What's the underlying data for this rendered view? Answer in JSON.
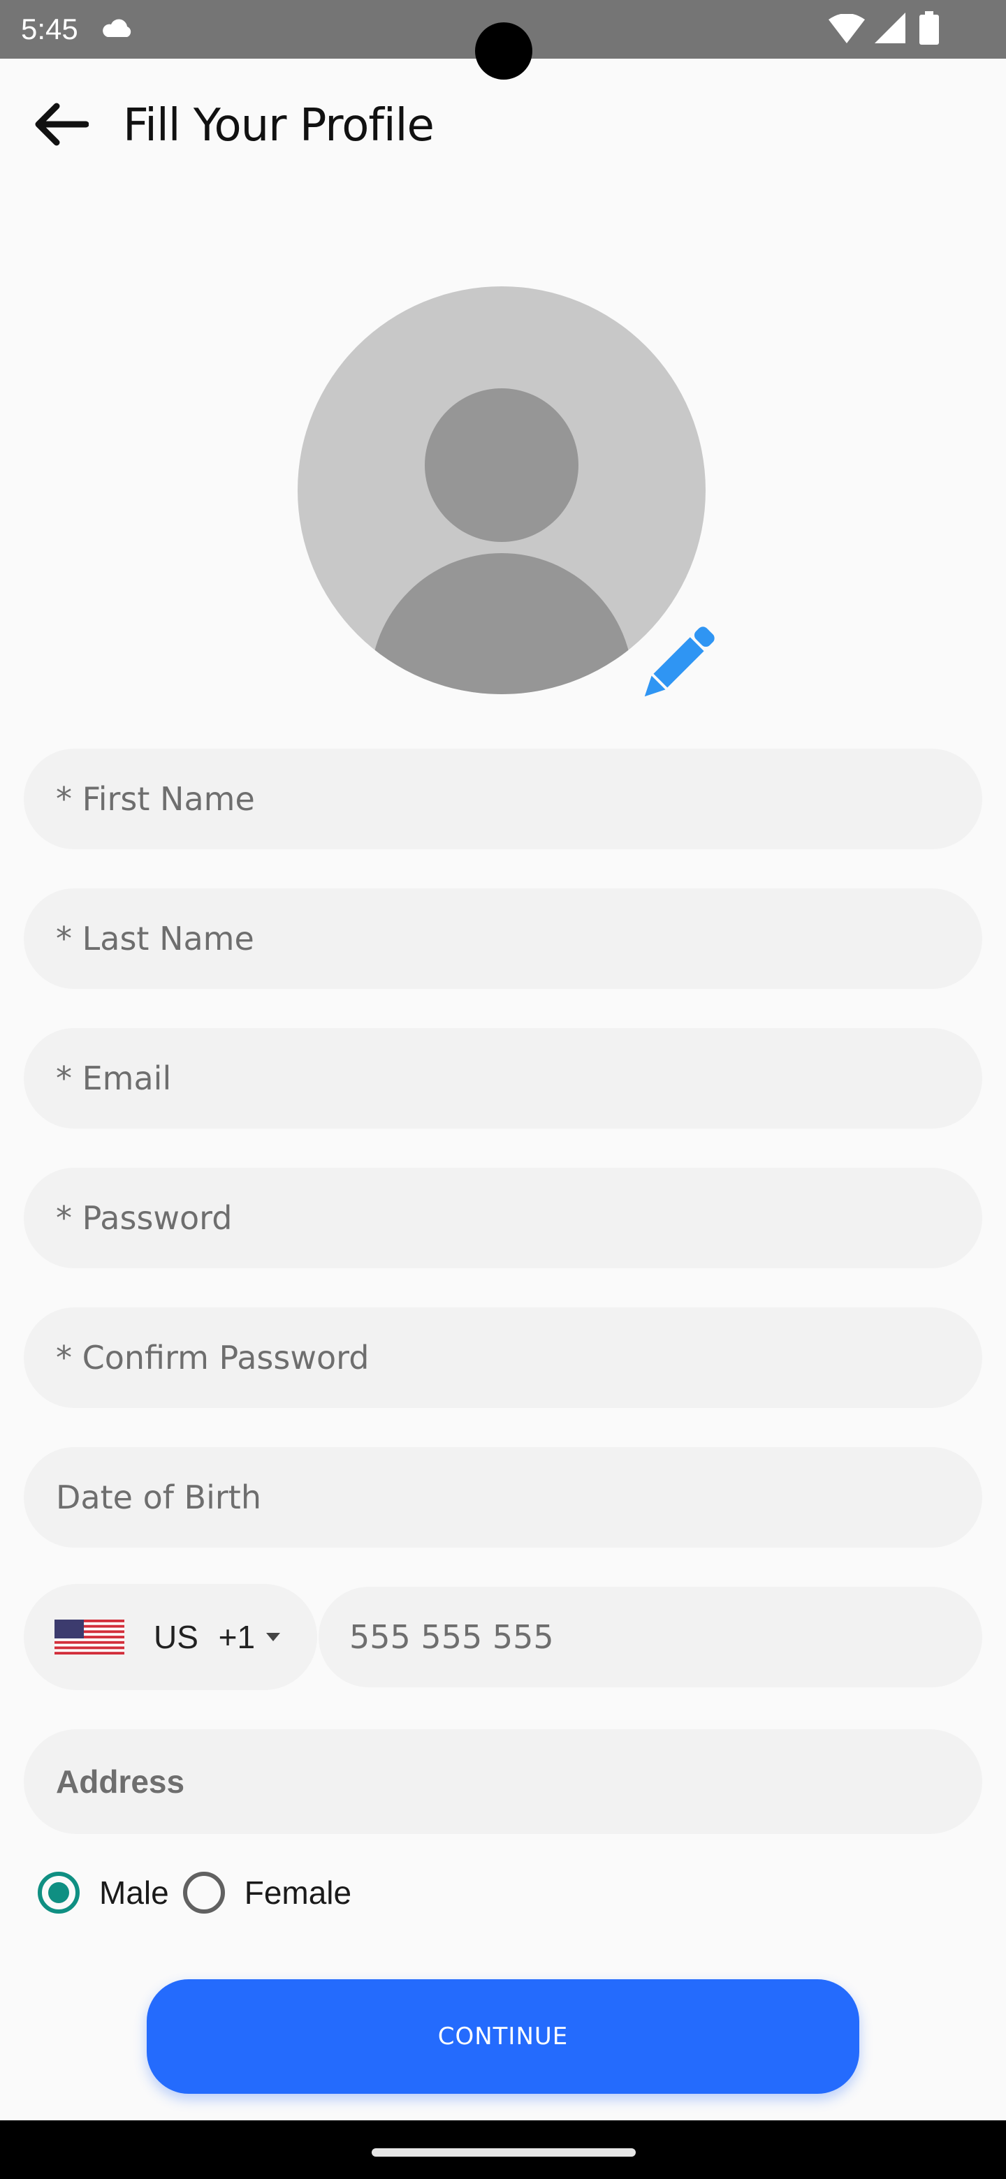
{
  "status_bar": {
    "time": "5:45",
    "icons": [
      "cloud-icon",
      "wifi-icon",
      "signal-icon",
      "battery-icon"
    ],
    "background": "#757575"
  },
  "header": {
    "title": "Fill Your Profile",
    "back_icon": "arrow-left-icon"
  },
  "avatar": {
    "placeholder_icon": "person-silhouette-icon",
    "edit_icon": "pencil-icon",
    "edit_color": "#2f95f3"
  },
  "form": {
    "first_name": {
      "placeholder": "* First Name",
      "value": ""
    },
    "last_name": {
      "placeholder": "* Last Name",
      "value": ""
    },
    "email": {
      "placeholder": "* Email",
      "value": ""
    },
    "password": {
      "placeholder": "* Password",
      "value": ""
    },
    "confirm_password": {
      "placeholder": "* Confirm Password",
      "value": ""
    },
    "date_of_birth": {
      "placeholder": "Date of Birth",
      "value": ""
    },
    "phone": {
      "country_flag": "us-flag-icon",
      "country_code": "US +1",
      "placeholder": "555 555 555",
      "value": ""
    },
    "address": {
      "placeholder": "Address",
      "value": ""
    },
    "gender": {
      "options": [
        {
          "label": "Male",
          "selected": true
        },
        {
          "label": "Female",
          "selected": false
        }
      ]
    }
  },
  "actions": {
    "continue_label": "CONTINUE",
    "accent": "#246bfd",
    "radio_accent": "#0f8f82"
  }
}
